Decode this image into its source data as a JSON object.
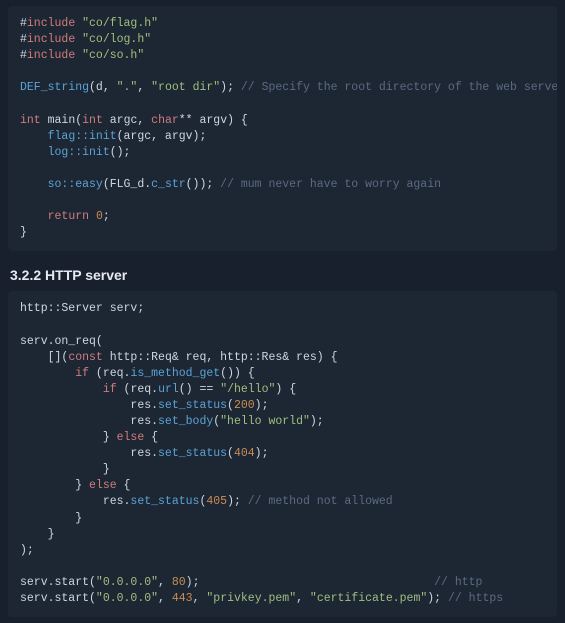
{
  "block1": {
    "l1": {
      "inc": "include",
      "path": "\"co/flag.h\""
    },
    "l2": {
      "inc": "include",
      "path": "\"co/log.h\""
    },
    "l3": {
      "inc": "include",
      "path": "\"co/so.h\""
    },
    "l4": {
      "def": "DEF_string",
      "args_a": "(d, ",
      "args_b": "\".\"",
      "args_c": ", ",
      "args_d": "\"root dir\"",
      "args_e": ");",
      "cmt": " // Specify the root directory of the web server"
    },
    "l5": {
      "kw_int": "int",
      "main": " main(",
      "kw_int2": "int",
      "argc": " argc, ",
      "kw_char": "char",
      "argv": "** argv) {"
    },
    "l6": {
      "fn": "flag::init",
      "rest": "(argc, argv);"
    },
    "l7": {
      "fn": "log::init",
      "rest": "();"
    },
    "l8": {
      "fn": "so::easy",
      "mid": "(FLG_d.",
      "cstr": "c_str",
      "end": "());",
      "cmt": " // mum never have to worry again"
    },
    "l9": {
      "ret": "return",
      "sp": " ",
      "num": "0",
      "semi": ";"
    },
    "l10": {
      "brace": "}"
    }
  },
  "heading": "3.2.2 HTTP server",
  "block2": {
    "l1": "http::Server serv;",
    "l2": "serv.on_req(",
    "l3a": "    [](",
    "l3b": "const",
    "l3c": " http::Req& req, http::Res& res) {",
    "l4a": "        ",
    "l4b": "if",
    "l4c": " (req.",
    "l4d": "is_method_get",
    "l4e": "()) {",
    "l5a": "            ",
    "l5b": "if",
    "l5c": " (req.",
    "l5d": "url",
    "l5e": "() == ",
    "l5f": "\"/hello\"",
    "l5g": ") {",
    "l6a": "                res.",
    "l6b": "set_status",
    "l6c": "(",
    "l6d": "200",
    "l6e": ");",
    "l7a": "                res.",
    "l7b": "set_body",
    "l7c": "(",
    "l7d": "\"hello world\"",
    "l7e": ");",
    "l8a": "            } ",
    "l8b": "else",
    "l8c": " {",
    "l9a": "                res.",
    "l9b": "set_status",
    "l9c": "(",
    "l9d": "404",
    "l9e": ");",
    "l10": "            }",
    "l11a": "        } ",
    "l11b": "else",
    "l11c": " {",
    "l12a": "            res.",
    "l12b": "set_status",
    "l12c": "(",
    "l12d": "405",
    "l12e": ");",
    "l12f": " // method not allowed",
    "l13": "        }",
    "l14": "    }",
    "l15": ");",
    "l16a": "serv.start(",
    "l16b": "\"0.0.0.0\"",
    "l16c": ", ",
    "l16d": "80",
    "l16e": ");                                  ",
    "l16f": "// http",
    "l17a": "serv.start(",
    "l17b": "\"0.0.0.0\"",
    "l17c": ", ",
    "l17d": "443",
    "l17e": ", ",
    "l17f": "\"privkey.pem\"",
    "l17g": ", ",
    "l17h": "\"certificate.pem\"",
    "l17i": ");",
    "l17j": " // https"
  }
}
